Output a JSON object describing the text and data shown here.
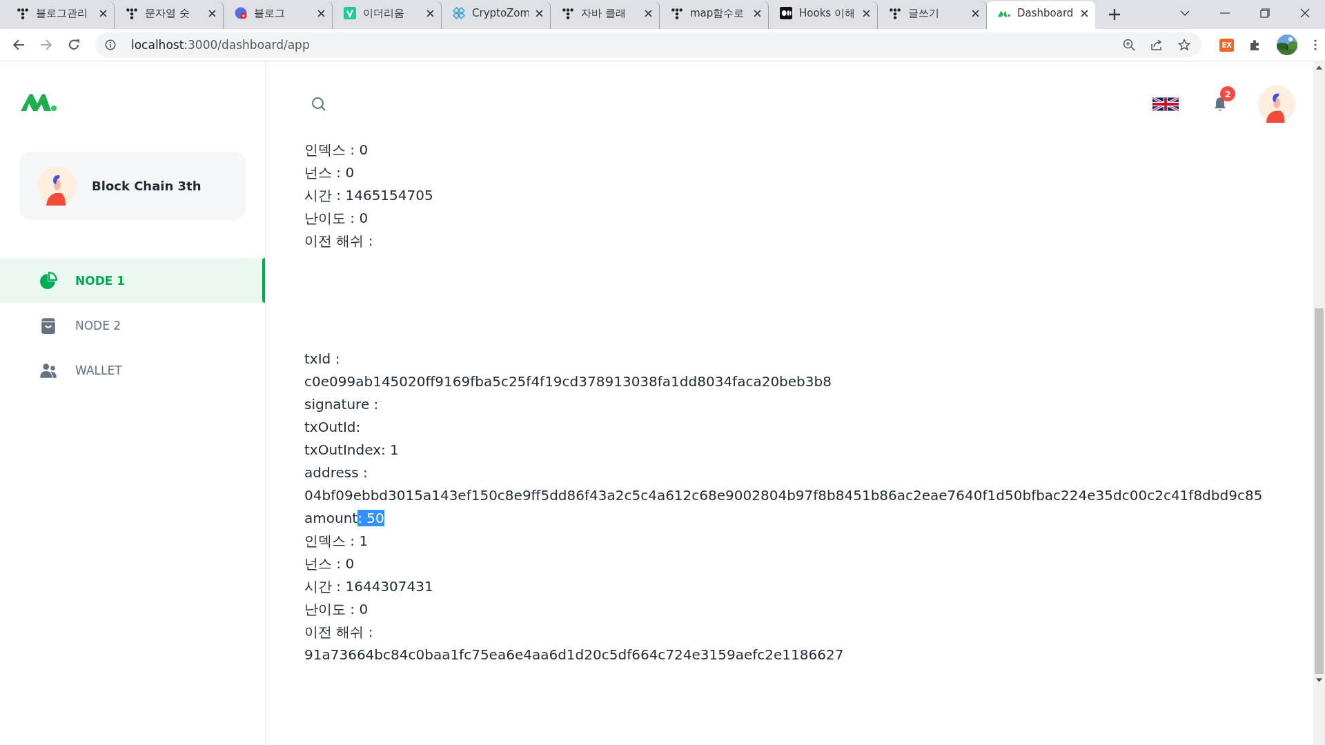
{
  "browser": {
    "tabs": [
      {
        "title": "블로그관리",
        "kind": "tistory",
        "selected": false
      },
      {
        "title": "문자열 숫",
        "kind": "tistory",
        "selected": false
      },
      {
        "title": "블로그",
        "kind": "blogger",
        "selected": false
      },
      {
        "title": "이더리움",
        "kind": "velog",
        "selected": false
      },
      {
        "title": "CryptoZom",
        "kind": "crypto",
        "selected": false
      },
      {
        "title": "자바 클래",
        "kind": "tistory",
        "selected": false
      },
      {
        "title": "map함수로",
        "kind": "tistory",
        "selected": false
      },
      {
        "title": "Hooks 이해",
        "kind": "medium",
        "selected": false
      },
      {
        "title": "글쓰기",
        "kind": "tistory",
        "selected": false
      },
      {
        "title": "Dashboard",
        "kind": "app",
        "selected": true
      }
    ],
    "address": {
      "host": "localhost",
      "path": ":3000/dashboard/app"
    },
    "extension_label": "EX"
  },
  "sidebar": {
    "account": {
      "name": "Block Chain 3th"
    },
    "items": [
      {
        "label": "NODE 1",
        "kind": "pie",
        "selected": true
      },
      {
        "label": "NODE 2",
        "kind": "bag",
        "selected": false
      },
      {
        "label": "WALLET",
        "kind": "people",
        "selected": false
      }
    ]
  },
  "header": {
    "notifications": "2"
  },
  "blocks": [
    {
      "lines": [
        {
          "text": "인덱스 : 0"
        },
        {
          "text": "넌스 : 0"
        },
        {
          "text": "시간 : 1465154705"
        },
        {
          "text": "난이도 : 0"
        },
        {
          "text": "이전 해쉬 :"
        }
      ]
    },
    {
      "lines": [
        {
          "text": "txId :"
        },
        {
          "text": "c0e099ab145020ff9169fba5c25f4f19cd378913038fa1dd8034faca20beb3b8"
        },
        {
          "text": "signature :"
        },
        {
          "text": "txOutId:"
        },
        {
          "text": "txOutIndex: 1"
        },
        {
          "text": "address :"
        },
        {
          "text": "04bf09ebbd3015a143ef150c8e9ff5dd86f43a2c5c4a612c68e9002804b97f8b8451b86ac2eae7640f1d50bfbac224e35dc00c2c41f8dbd9c85"
        },
        {
          "text": "amount",
          "highlighted_text": ": 50"
        },
        {
          "text": "인덱스 : 1"
        },
        {
          "text": "넌스 : 0"
        },
        {
          "text": "시간 : 1644307431"
        },
        {
          "text": "난이도 : 0"
        },
        {
          "text": "이전 해쉬 :"
        },
        {
          "text": "91a73664bc84c0baa1fc75ea6e4aa6d1d20c5df664c724e3159aefc2e1186627"
        }
      ]
    }
  ]
}
